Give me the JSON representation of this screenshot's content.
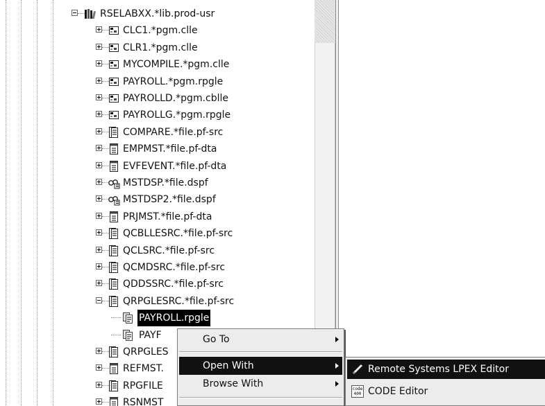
{
  "tree": {
    "rows": [
      {
        "label": "RSELABXX.*lib.prod-usr",
        "icon": "library-icon",
        "depth": 0,
        "expander": "minus",
        "selected": false
      },
      {
        "label": "CLC1.*pgm.clle",
        "icon": "program-icon",
        "depth": 1,
        "expander": "plus",
        "selected": false
      },
      {
        "label": "CLR1.*pgm.clle",
        "icon": "program-icon",
        "depth": 1,
        "expander": "plus",
        "selected": false
      },
      {
        "label": "MYCOMPILE.*pgm.clle",
        "icon": "program-icon",
        "depth": 1,
        "expander": "plus",
        "selected": false
      },
      {
        "label": "PAYROLL.*pgm.rpgle",
        "icon": "program-icon",
        "depth": 1,
        "expander": "plus",
        "selected": false
      },
      {
        "label": "PAYROLLD.*pgm.cblle",
        "icon": "program-icon",
        "depth": 1,
        "expander": "plus",
        "selected": false
      },
      {
        "label": "PAYROLLG.*pgm.rpgle",
        "icon": "program-icon",
        "depth": 1,
        "expander": "plus",
        "selected": false
      },
      {
        "label": "COMPARE.*file.pf-src",
        "icon": "source-file-icon",
        "depth": 1,
        "expander": "plus",
        "selected": false
      },
      {
        "label": "EMPMST.*file.pf-dta",
        "icon": "data-file-icon",
        "depth": 1,
        "expander": "plus",
        "selected": false
      },
      {
        "label": "EVFEVENT.*file.pf-dta",
        "icon": "data-file-icon",
        "depth": 1,
        "expander": "plus",
        "selected": false
      },
      {
        "label": "MSTDSP.*file.dspf",
        "icon": "display-file-icon",
        "depth": 1,
        "expander": "plus",
        "selected": false
      },
      {
        "label": "MSTDSP2.*file.dspf",
        "icon": "display-file-icon",
        "depth": 1,
        "expander": "plus",
        "selected": false
      },
      {
        "label": "PRJMST.*file.pf-dta",
        "icon": "data-file-icon",
        "depth": 1,
        "expander": "plus",
        "selected": false
      },
      {
        "label": "QCBLLESRC.*file.pf-src",
        "icon": "source-file-icon",
        "depth": 1,
        "expander": "plus",
        "selected": false
      },
      {
        "label": "QCLSRC.*file.pf-src",
        "icon": "source-file-icon",
        "depth": 1,
        "expander": "plus",
        "selected": false
      },
      {
        "label": "QCMDSRC.*file.pf-src",
        "icon": "source-file-icon",
        "depth": 1,
        "expander": "plus",
        "selected": false
      },
      {
        "label": "QDDSSRC.*file.pf-src",
        "icon": "source-file-icon",
        "depth": 1,
        "expander": "plus",
        "selected": false
      },
      {
        "label": "QRPGLESRC.*file.pf-src",
        "icon": "source-file-icon",
        "depth": 1,
        "expander": "minus",
        "selected": false
      },
      {
        "label": "PAYROLL.rpgle",
        "icon": "member-icon",
        "depth": 2,
        "expander": "none",
        "selected": true
      },
      {
        "label": "PAYF",
        "icon": "member-icon",
        "depth": 2,
        "expander": "none",
        "selected": false
      },
      {
        "label": "QRPGLES",
        "icon": "source-file-icon",
        "depth": 1,
        "expander": "plus",
        "selected": false
      },
      {
        "label": "REFMST.",
        "icon": "data-file-icon",
        "depth": 1,
        "expander": "plus",
        "selected": false
      },
      {
        "label": "RPGFILE",
        "icon": "source-file-icon",
        "depth": 1,
        "expander": "plus",
        "selected": false
      },
      {
        "label": "RSNMST",
        "icon": "data-file-icon",
        "depth": 1,
        "expander": "plus",
        "selected": false
      }
    ]
  },
  "context_menu": {
    "items": [
      {
        "label": "Go To",
        "has_submenu": true,
        "highlighted": false
      },
      {
        "label": "Open With",
        "has_submenu": true,
        "highlighted": true
      },
      {
        "label": "Browse With",
        "has_submenu": true,
        "highlighted": false
      }
    ]
  },
  "submenu": {
    "items": [
      {
        "label": "Remote Systems LPEX Editor",
        "icon": "lpex-editor-icon",
        "highlighted": true
      },
      {
        "label": "CODE Editor",
        "icon": "code-editor-icon",
        "badge_top": "code",
        "badge_bottom": "400",
        "highlighted": false
      }
    ]
  }
}
